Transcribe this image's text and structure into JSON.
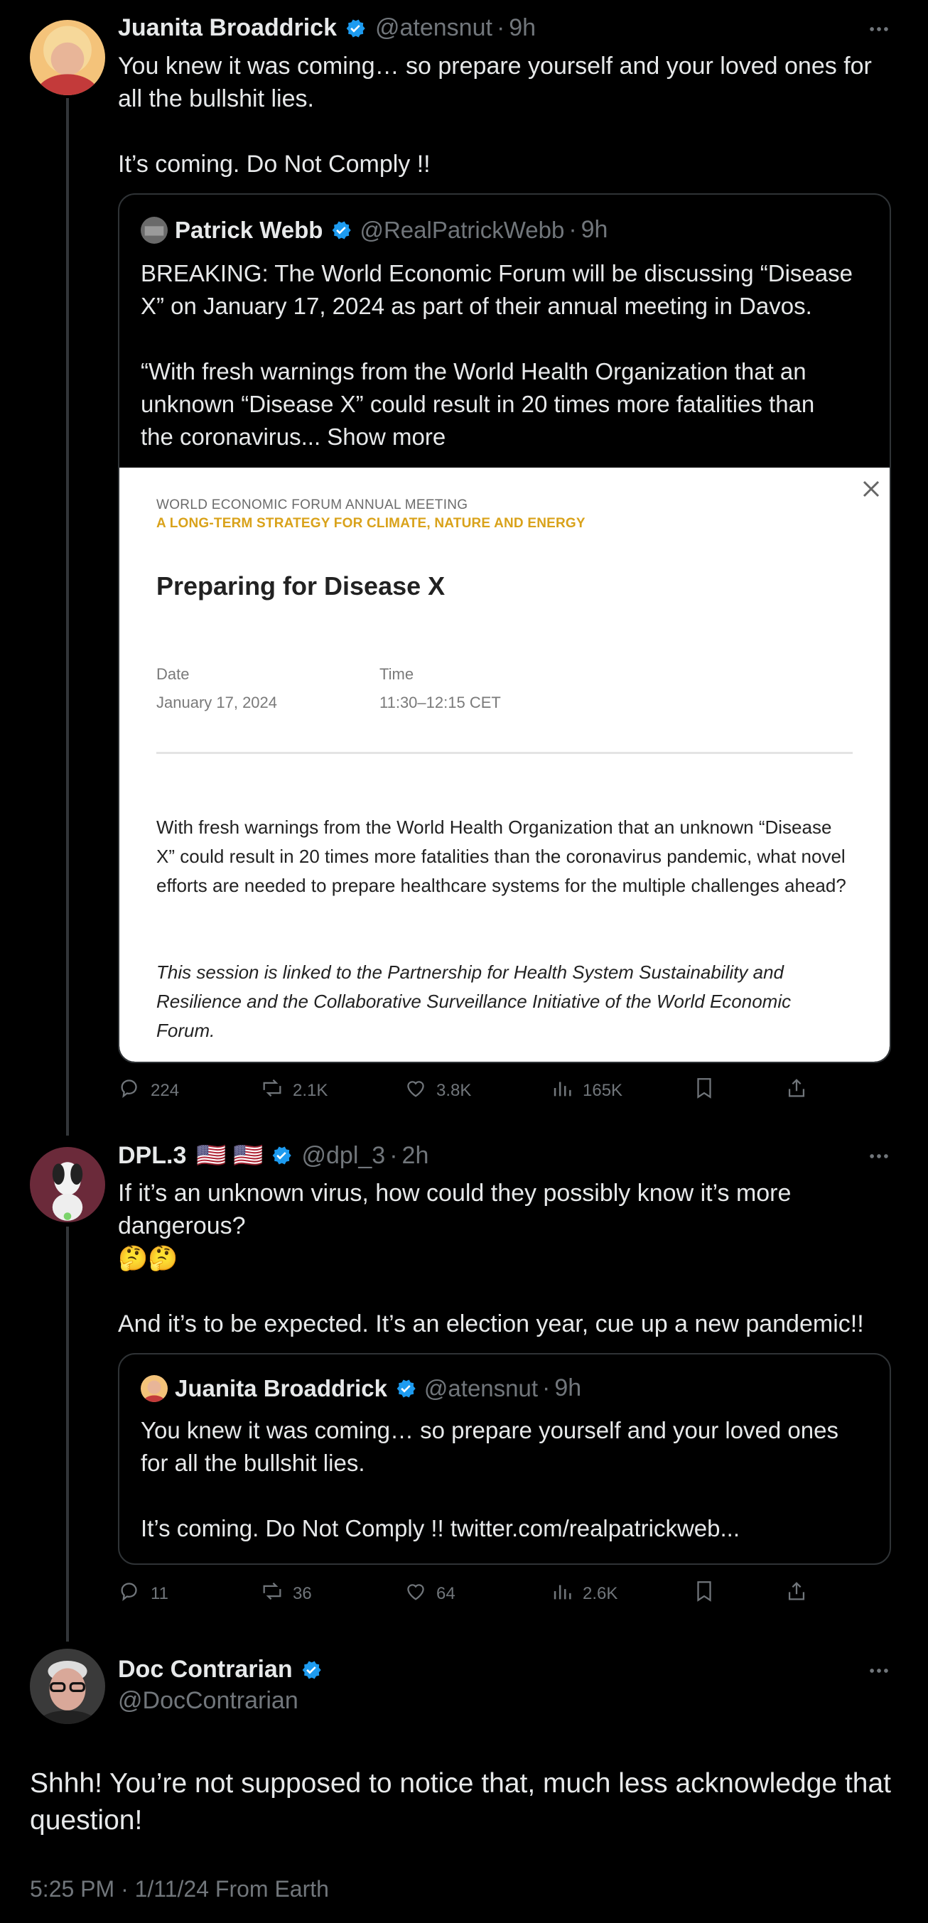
{
  "tweets": [
    {
      "name": "Juanita Broaddrick",
      "handle": "@atensnut",
      "sep": "·",
      "time": "9h",
      "text": "You knew it was coming… so prepare yourself and your loved ones for\nall the bullshit lies.\n\nIt’s coming. Do Not Comply !!",
      "quote": {
        "name": "Patrick Webb",
        "handle": "@RealPatrickWebb",
        "sep": "·",
        "time": "9h",
        "text": "BREAKING: The World Economic Forum will be discussing “Disease\nX” on January 17, 2024 as part of their annual meeting in Davos.\n\n“With fresh warnings from the World Health Organization that an\nunknown “Disease X” could result in 20 times more fatalities than\nthe coronavirus... Show more",
        "card": {
          "kicker": "WORLD ECONOMIC FORUM ANNUAL MEETING",
          "subtitle": "A LONG-TERM STRATEGY FOR CLIMATE, NATURE AND ENERGY",
          "title": "Preparing for Disease X",
          "date_label": "Date",
          "date_value": "January 17, 2024",
          "time_label": "Time",
          "time_value": "11:30–12:15 CET",
          "body": "With fresh warnings from the World Health Organization that an unknown “Disease X” could result in 20 times more fatalities than the coronavirus pandemic, what novel efforts are needed to prepare healthcare systems for the multiple challenges ahead?",
          "note": "This session is linked to the Partnership for Health System Sustainability and Resilience and the Collaborative Surveillance Initiative of the World Economic Forum."
        }
      },
      "stats": {
        "replies": "224",
        "reposts": "2.1K",
        "likes": "3.8K",
        "views": "165K"
      }
    },
    {
      "name": "DPL.3",
      "flags": "🇺🇸 🇺🇸",
      "handle": "@dpl_3",
      "sep": "·",
      "time": "2h",
      "text": "If it’s an unknown virus, how could they possibly know it’s more\ndangerous?\n🤔🤔\n\nAnd it’s to be expected. It’s an election year, cue up a new pandemic!!",
      "quote": {
        "name": "Juanita Broaddrick",
        "handle": "@atensnut",
        "sep": "·",
        "time": "9h",
        "text": "You knew it was coming… so prepare yourself and your loved ones\nfor all the bullshit lies.\n\nIt’s coming. Do Not Comply !! twitter.com/realpatrickweb..."
      },
      "stats": {
        "replies": "11",
        "reposts": "36",
        "likes": "64",
        "views": "2.6K"
      }
    },
    {
      "name": "Doc Contrarian",
      "handle": "@DocContrarian",
      "text": "Shhh! You’re not supposed to notice that, much less acknowledge that question!",
      "meta": "5:25 PM · 1/11/24 From Earth"
    }
  ],
  "colors": {
    "background": "#000000",
    "text": "#e7e9ea",
    "muted": "#71767b",
    "verified": "#1d9bf0",
    "border": "#2f3336",
    "card_accent": "#d9a21a"
  },
  "icons": [
    "more-icon",
    "verified-icon",
    "reply-icon",
    "repost-icon",
    "like-icon",
    "views-icon",
    "bookmark-icon",
    "share-icon",
    "close-icon"
  ]
}
